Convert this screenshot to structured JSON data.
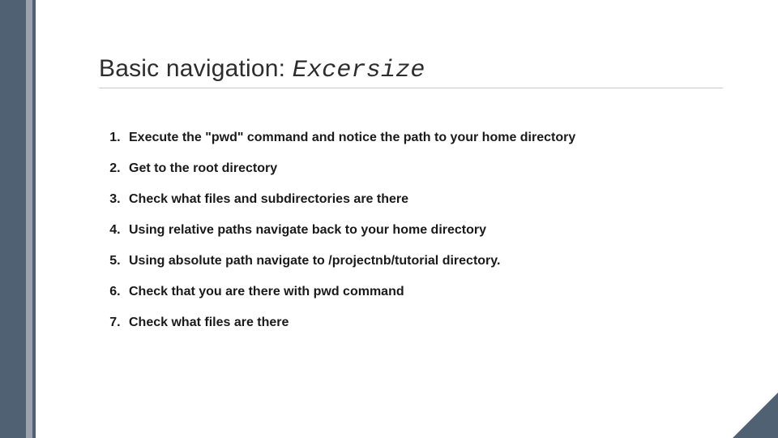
{
  "title": {
    "prefix": "Basic navigation: ",
    "mono": "Excersize"
  },
  "items": [
    "Execute the \"pwd\" command and notice the path to your home directory",
    "Get to the root directory",
    "Check what files and subdirectories are there",
    "Using relative paths navigate back to your home directory",
    "Using absolute path navigate to /projectnb/tutorial directory.",
    "Check that you are there with pwd command",
    "Check what files are there"
  ]
}
